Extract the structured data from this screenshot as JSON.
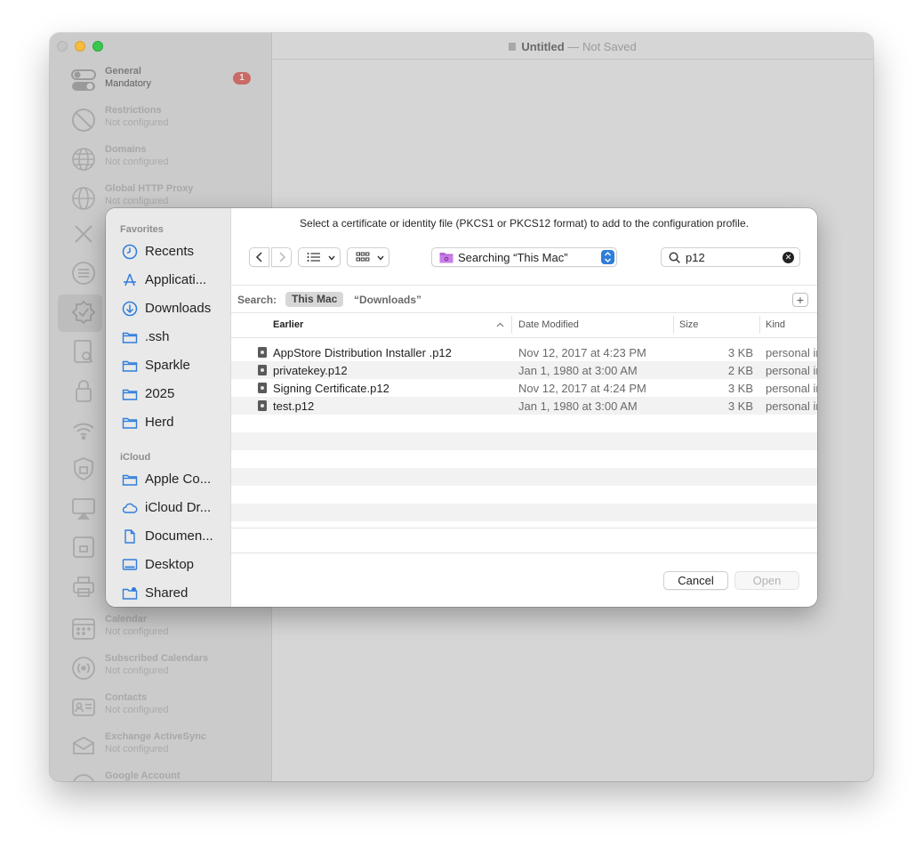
{
  "window": {
    "title": "Untitled",
    "title_separator": "—",
    "title_status": "Not Saved"
  },
  "payloads": [
    {
      "name": "General",
      "status": "Mandatory",
      "icon": "toggle-icon",
      "badge": "1"
    },
    {
      "name": "Restrictions",
      "status": "Not configured",
      "icon": "no-entry-icon"
    },
    {
      "name": "Domains",
      "status": "Not configured",
      "icon": "globe-icon"
    },
    {
      "name": "Global HTTP Proxy",
      "status": "Not configured",
      "icon": "globe-gear-icon"
    },
    {
      "name": "Calendar",
      "status": "Not configured",
      "icon": "calendar-icon"
    },
    {
      "name": "Subscribed Calendars",
      "status": "Not configured",
      "icon": "broadcast-icon"
    },
    {
      "name": "Contacts",
      "status": "Not configured",
      "icon": "contact-card-icon"
    },
    {
      "name": "Exchange ActiveSync",
      "status": "Not configured",
      "icon": "inbox-icon"
    },
    {
      "name": "Google Account",
      "status": "",
      "icon": "account-icon"
    }
  ],
  "dialog": {
    "prompt": "Select a certificate or identity file (PKCS1 or PKCS12 format) to add to the configuration profile.",
    "location": "Searching “This Mac”",
    "search_value": "p12",
    "scope": {
      "label": "Search:",
      "selected": "This Mac",
      "other": "“Downloads”"
    },
    "columns": {
      "name": "Earlier",
      "date": "Date Modified",
      "size": "Size",
      "kind": "Kind"
    },
    "files": [
      {
        "name": "AppStore Distribution Installer .p12",
        "date": "Nov 12, 2017 at 4:23 PM",
        "size": "3 KB",
        "kind": "personal information exchange"
      },
      {
        "name": "privatekey.p12",
        "date": "Jan 1, 1980 at 3:00 AM",
        "size": "2 KB",
        "kind": "personal information exchange"
      },
      {
        "name": "Signing Certificate.p12",
        "date": "Nov 12, 2017 at 4:24 PM",
        "size": "3 KB",
        "kind": "personal information exchange"
      },
      {
        "name": "test.p12",
        "date": "Jan 1, 1980 at 3:00 AM",
        "size": "3 KB",
        "kind": "personal information exchange"
      }
    ],
    "cancel_label": "Cancel",
    "open_label": "Open"
  },
  "sidebar": {
    "favorites_header": "Favorites",
    "favorites": [
      {
        "label": "Recents",
        "icon": "clock-icon"
      },
      {
        "label": "Applicati...",
        "icon": "applications-icon"
      },
      {
        "label": "Downloads",
        "icon": "download-icon"
      },
      {
        "label": ".ssh",
        "icon": "folder-icon"
      },
      {
        "label": "Sparkle",
        "icon": "folder-icon"
      },
      {
        "label": "2025",
        "icon": "folder-icon"
      },
      {
        "label": "Herd",
        "icon": "folder-icon"
      }
    ],
    "icloud_header": "iCloud",
    "icloud": [
      {
        "label": "Apple Co...",
        "icon": "folder-icon"
      },
      {
        "label": "iCloud Dr...",
        "icon": "cloud-icon"
      },
      {
        "label": "Documen...",
        "icon": "document-icon"
      },
      {
        "label": "Desktop",
        "icon": "desktop-icon"
      },
      {
        "label": "Shared",
        "icon": "shared-folder-icon"
      }
    ]
  },
  "colors": {
    "accent": "#2f7ddb",
    "badge": "#c86b66",
    "location_folder": "#b565d9"
  }
}
